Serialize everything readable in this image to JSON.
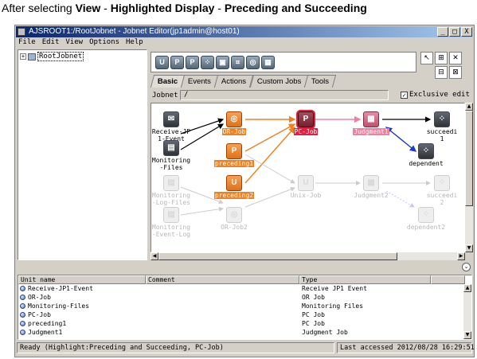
{
  "caption": {
    "prefix": "After selecting ",
    "view": "View",
    "sep1": " - ",
    "highlighted": "Highlighted Display",
    "sep2": " - ",
    "preceding": "Preceding and Succeeding"
  },
  "window": {
    "title": "AJSROOT1:/RootJobnet - Jobnet Editor(jp1admin@host01)",
    "minimize": "_",
    "maximize": "□",
    "close": "X"
  },
  "menu": [
    "File",
    "Edit",
    "View",
    "Options",
    "Help"
  ],
  "tree": {
    "expand": "+",
    "root_label": "RootJobnet"
  },
  "iconbar": [
    "U",
    "P",
    "P",
    "",
    "",
    "",
    "",
    ""
  ],
  "tabs": [
    "Basic",
    "Events",
    "Actions",
    "Custom Jobs",
    "Tools"
  ],
  "jobnet": {
    "label": "Jobnet :",
    "value": "/",
    "exclusive_label": "Exclusive edit",
    "exclusive_checked": true
  },
  "jobs": {
    "receive": "Receive-JP\n1-Event",
    "or_job": "OR-Job",
    "pc_job": "PC-Job",
    "judgment1": "Judgment1",
    "succeeding1": "succeedi\n1",
    "monitoring_files": "Monitoring\n-Files",
    "preceding1": "preceding1",
    "dependent": "dependent",
    "monitoring_log": "Monitoring\n-Log-Files",
    "preceding2": "preceding2",
    "unix_job": "Unix-Job",
    "judgment2": "Judgment2",
    "succeeding2": "succeedi\n2",
    "monitoring_event": "Monitoring\n-Event-Log",
    "or_job2": "OR-Job2",
    "dependent2": "dependent2"
  },
  "colors": {
    "orange": "#f08020",
    "red": "#e02040",
    "pink": "#f080a0",
    "blue": "#1a3cc8",
    "black": "#000000",
    "dim": "#cccccc"
  },
  "list": {
    "headers": [
      "Unit name",
      "Comment",
      "Type"
    ],
    "rows": [
      {
        "name": "Receive-JP1-Event",
        "type": "Receive JP1 Event"
      },
      {
        "name": "OR-Job",
        "type": "OR Job"
      },
      {
        "name": "Monitoring-Files",
        "type": "Monitoring Files"
      },
      {
        "name": "PC-Job",
        "type": "PC Job"
      },
      {
        "name": "preceding1",
        "type": "PC Job"
      },
      {
        "name": "Judgment1",
        "type": "Judgment Job"
      }
    ]
  },
  "status": {
    "left": "Ready (Highlight:Preceding and Succeeding, PC-Job)",
    "right": "Last accessed 2012/08/28 16:29:51"
  }
}
